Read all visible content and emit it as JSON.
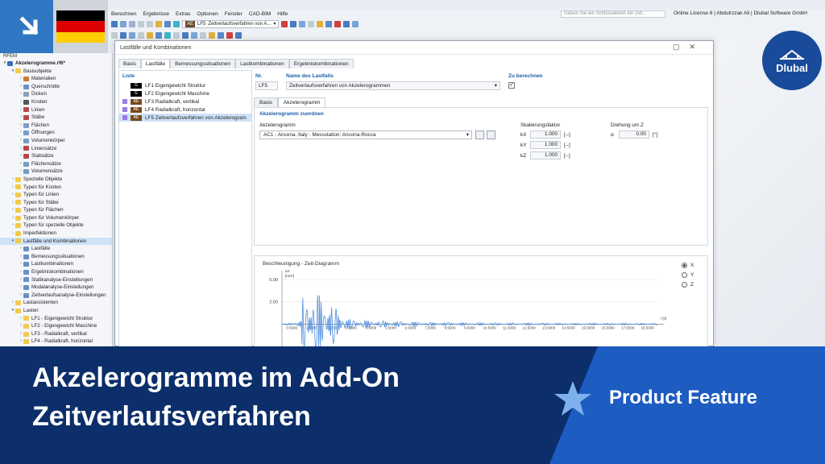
{
  "app": {
    "menu": [
      "Berechnen",
      "Ergebnisse",
      "Extras",
      "Optionen",
      "Fenster",
      "CAD-BIM",
      "Hilfe"
    ],
    "search_placeholder": "Geben Sie ein Schlüsselwort ein (Alt...",
    "license_text": "Online License 8 | Abdulrzzak Ali | Dlubal Software GmbH",
    "toolbar_loadcase": {
      "tag": "AE",
      "id": "LF5",
      "name": "Zeitverlaufsverfahren von A..."
    }
  },
  "navigator": {
    "title": "RFEM",
    "items": [
      {
        "label": "Akzelerogramme.rf6*",
        "level": 0,
        "expanded": true,
        "icon": "#3a6fb0",
        "bold": true
      },
      {
        "label": "Basisobjekte",
        "level": 1,
        "expanded": true,
        "icon": "#f2c94c"
      },
      {
        "label": "Materialien",
        "level": 2,
        "icon": "#c77d3a"
      },
      {
        "label": "Querschnitte",
        "level": 2,
        "icon": "#6a8fc7"
      },
      {
        "label": "Dicken",
        "level": 2,
        "icon": "#8aa0b8"
      },
      {
        "label": "Knoten",
        "level": 2,
        "icon": "#555555"
      },
      {
        "label": "Linien",
        "level": 2,
        "icon": "#b24a4a"
      },
      {
        "label": "Stäbe",
        "level": 2,
        "icon": "#b24a4a"
      },
      {
        "label": "Flächen",
        "level": 2,
        "icon": "#7a9cc7"
      },
      {
        "label": "Öffnungen",
        "level": 2,
        "icon": "#7a9cc7"
      },
      {
        "label": "Volumenkörper",
        "level": 2,
        "icon": "#7a9cc7"
      },
      {
        "label": "Liniensätze",
        "level": 2,
        "icon": "#b24a4a"
      },
      {
        "label": "Stabsätze",
        "level": 2,
        "icon": "#b24a4a"
      },
      {
        "label": "Flächensätze",
        "level": 2,
        "icon": "#7a9cc7"
      },
      {
        "label": "Volumensätze",
        "level": 2,
        "icon": "#7a9cc7"
      },
      {
        "label": "Spezielle Objekte",
        "level": 1,
        "icon": "#f2c94c"
      },
      {
        "label": "Typen für Knoten",
        "level": 1,
        "icon": "#f2c94c"
      },
      {
        "label": "Typen für Linien",
        "level": 1,
        "icon": "#f2c94c"
      },
      {
        "label": "Typen für Stäbe",
        "level": 1,
        "icon": "#f2c94c"
      },
      {
        "label": "Typen für Flächen",
        "level": 1,
        "icon": "#f2c94c"
      },
      {
        "label": "Typen für Volumenkörper",
        "level": 1,
        "icon": "#f2c94c"
      },
      {
        "label": "Typen für spezielle Objekte",
        "level": 1,
        "icon": "#f2c94c"
      },
      {
        "label": "Imperfektionen",
        "level": 1,
        "icon": "#f2c94c"
      },
      {
        "label": "Lastfälle und Kombinationen",
        "level": 1,
        "expanded": true,
        "icon": "#f2c94c",
        "selected": true
      },
      {
        "label": "Lastfälle",
        "level": 2,
        "icon": "#6a8fc7"
      },
      {
        "label": "Bemessungssituationen",
        "level": 2,
        "icon": "#6a8fc7"
      },
      {
        "label": "Lastkombinationen",
        "level": 2,
        "icon": "#6a8fc7"
      },
      {
        "label": "Ergebniskombinationen",
        "level": 2,
        "icon": "#6a8fc7"
      },
      {
        "label": "Statikanalyse-Einstellungen",
        "level": 2,
        "icon": "#6a8fc7"
      },
      {
        "label": "Modalanalyse-Einstellungen",
        "level": 2,
        "icon": "#6a8fc7"
      },
      {
        "label": "Zeitverlaufsanalyse-Einstellungen",
        "level": 2,
        "icon": "#6a8fc7"
      },
      {
        "label": "Lastassistenten",
        "level": 1,
        "icon": "#f2c94c"
      },
      {
        "label": "Lasten",
        "level": 1,
        "expanded": true,
        "icon": "#f2c94c"
      },
      {
        "label": "LF1 - Eigengewicht Struktur",
        "level": 2,
        "icon": "#f2c94c"
      },
      {
        "label": "LF2 - Eigengewicht Maschine",
        "level": 2,
        "icon": "#f2c94c"
      },
      {
        "label": "LF3 - Radialkraft, vertikal",
        "level": 2,
        "icon": "#f2c94c"
      },
      {
        "label": "LF4 - Radialkraft, horizontal",
        "level": 2,
        "icon": "#f2c94c"
      }
    ]
  },
  "dialog": {
    "title": "Lastfälle und Kombinationen",
    "tabs": [
      "Basis",
      "Lastfälle",
      "Bemessungssituationen",
      "Lastkombinationen",
      "Ergebniskombinationen"
    ],
    "active_tab": 1,
    "list_header": "Liste",
    "loadcases": [
      {
        "swatch": "#ffffff",
        "tag": "G",
        "tag_color": "#000000",
        "label": "LF1  Eigengewicht Struktur"
      },
      {
        "swatch": "#ffffff",
        "tag": "G",
        "tag_color": "#000000",
        "label": "LF2  Eigengewicht Maschine"
      },
      {
        "swatch": "#9b7be8",
        "tag": "AE",
        "tag_color": "#7a4a1c",
        "label": "LF3  Radialkraft, vertikal"
      },
      {
        "swatch": "#9b7be8",
        "tag": "AE",
        "tag_color": "#7a4a1c",
        "label": "LF4  Radialkraft, horizontal"
      },
      {
        "swatch": "#9b7be8",
        "tag": "AE",
        "tag_color": "#7a4a1c",
        "label": "LF5  Zeitverlaufsverfahren von Akzelerogram",
        "selected": true
      }
    ],
    "no_label": "Nr.",
    "no_value": "LF5",
    "name_label": "Name des Lastfalls",
    "name_value": "Zeitverlaufsverfahren von Akzelerogrammen",
    "calc_label": "Zu berechnen",
    "calc_checked": "✓",
    "inner_tabs": [
      "Basis",
      "Akzelerogramm"
    ],
    "section_title": "Akzelerogramm zuordnen",
    "accel_label": "Akzelerogramm",
    "accel_value": "AC1 - Ancona, Italy - Messstation: Ancona-Rocca",
    "scale_label": "Skalierungsfaktor",
    "factors": [
      {
        "label": "kX",
        "value": "1.000",
        "unit": "[--]"
      },
      {
        "label": "kY",
        "value": "1.000",
        "unit": "[--]"
      },
      {
        "label": "kZ",
        "value": "1.000",
        "unit": "[--]"
      }
    ],
    "rotation_label": "Drehung um Z",
    "rotation_symbol": "α",
    "rotation_value": "0.00",
    "rotation_unit": "[°]",
    "diagram_title": "Beschleunigung - Zeit-Diagramm",
    "axis_radios": [
      "X",
      "Y",
      "Z"
    ],
    "axis_selected": 0
  },
  "chart_data": {
    "type": "line",
    "title": "Beschleunigung - Zeit-Diagramm",
    "ylabel_symbol": "aX",
    "ylabel_unit": "[m/s²]",
    "xlabel": "t [s]",
    "yticks": [
      "5.00",
      "2.50"
    ],
    "xticks": [
      "0.5000",
      "1.5000",
      "2.5000",
      "3.5000",
      "4.5000",
      "5.5000",
      "6.5000",
      "7.5000",
      "8.5000",
      "9.5000",
      "10.5000",
      "11.5000",
      "12.5000",
      "13.5000",
      "14.5000",
      "15.5000",
      "16.5000",
      "17.5000",
      "18.5000"
    ],
    "xlim": [
      0,
      19.0
    ],
    "ylim": [
      -2.5,
      6.0
    ],
    "color": "#4f8fe0"
  },
  "banner": {
    "line1": "Akzelerogramme im Add-On",
    "line2": "Zeitverlaufsverfahren",
    "tag": "Product Feature"
  },
  "brand": {
    "logo_text": "Dlubal"
  }
}
